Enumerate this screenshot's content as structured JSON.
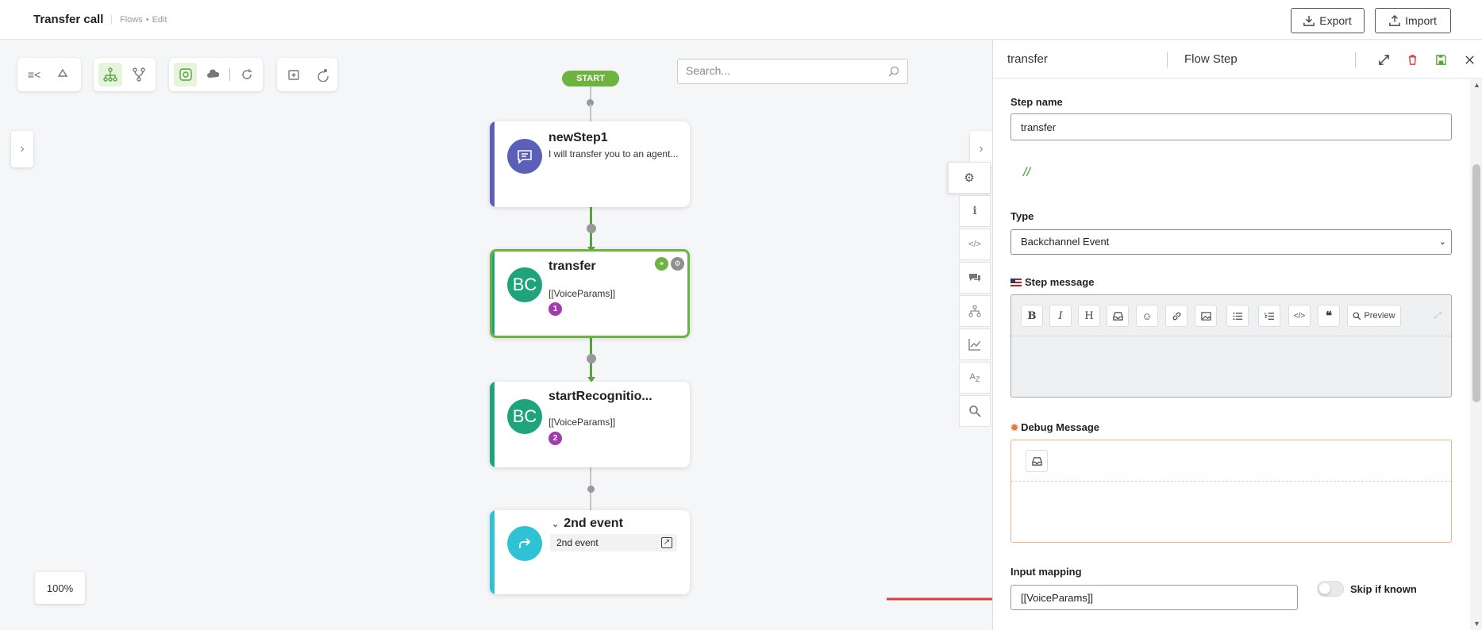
{
  "header": {
    "title": "Transfer call",
    "breadcrumb": [
      "Flows",
      "Edit"
    ],
    "export_label": "Export",
    "import_label": "Import"
  },
  "canvas": {
    "search_placeholder": "Search...",
    "start_label": "START",
    "zoom": "100%",
    "nodes": [
      {
        "title": "newStep1",
        "subtitle": "I will transfer you to an agent...",
        "icon": "chat-icon",
        "color": "#5c5fb8"
      },
      {
        "title": "transfer",
        "subtitle": "[[VoiceParams]]",
        "avatar": "BC",
        "badge": "1",
        "color": "#1fa37a",
        "selected": true
      },
      {
        "title": "startRecognitio...",
        "subtitle": "[[VoiceParams]]",
        "avatar": "BC",
        "badge": "2",
        "color": "#1fa37a"
      },
      {
        "title": "2nd event",
        "subtitle": "2nd event",
        "icon": "redirect-icon",
        "color": "#2fc2d4"
      }
    ]
  },
  "panel": {
    "name": "transfer",
    "type": "Flow Step",
    "step_name_label": "Step name",
    "step_name_value": "transfer",
    "comment": "//",
    "type_label": "Type",
    "type_value": "Backchannel Event",
    "step_message_label": "Step message",
    "preview_label": "Preview",
    "debug_label": "Debug Message",
    "input_mapping_label": "Input mapping",
    "input_mapping_value": "[[VoiceParams]]",
    "skip_label": "Skip if known"
  },
  "colors": {
    "accent_green": "#6db33f",
    "badge_purple": "#a23bb0",
    "arrow_red": "#e0393e"
  }
}
